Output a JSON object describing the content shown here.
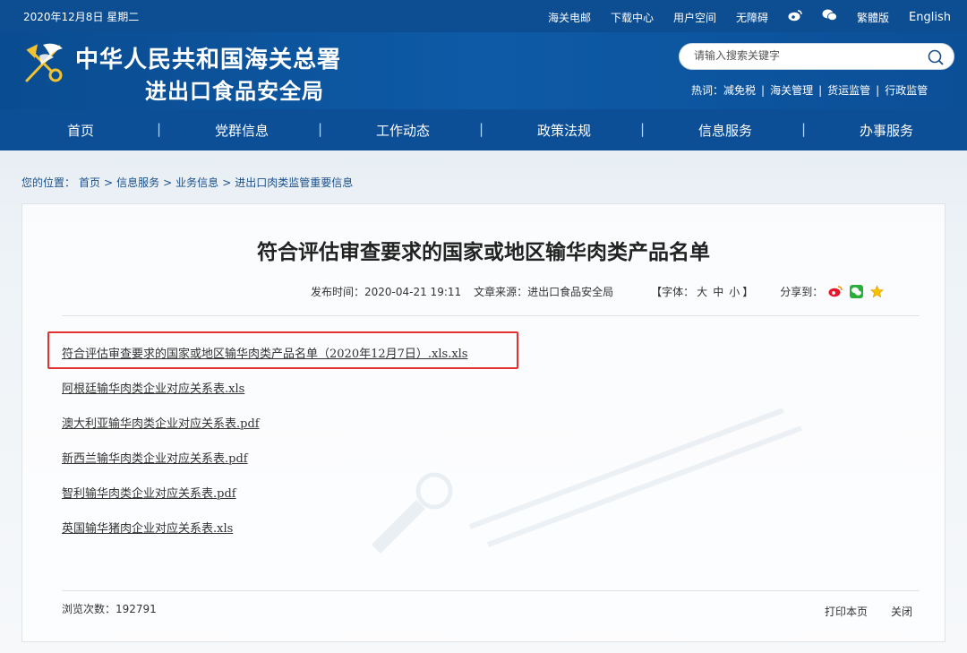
{
  "topbar": {
    "date": "2020年12月8日 星期二",
    "links": {
      "email": "海关电邮",
      "download": "下载中心",
      "user_space": "用户空间",
      "accessibility": "无障碍",
      "traditional": "繁體版",
      "english": "English"
    }
  },
  "header": {
    "title_line1": "中华人民共和国海关总署",
    "title_line2": "进出口食品安全局",
    "search": {
      "placeholder": "请输入搜索关键字"
    },
    "hot": {
      "label": "热词：",
      "items": [
        "减免税",
        "海关管理",
        "货运监管",
        "行政监管"
      ]
    }
  },
  "nav": {
    "items": [
      "首页",
      "党群信息",
      "工作动态",
      "政策法规",
      "信息服务",
      "办事服务"
    ]
  },
  "breadcrumb": {
    "label": "您的位置：",
    "items": [
      "首页",
      "信息服务",
      "业务信息",
      "进出口肉类监管重要信息"
    ],
    "separator": ">"
  },
  "article": {
    "title": "符合评估审查要求的国家或地区输华肉类产品名单",
    "publish_time": "发布时间：2020-04-21 19:11",
    "source": "文章来源：进出口食品安全局",
    "font_label": "【字体：",
    "font_sizes": [
      "大",
      "中",
      "小"
    ],
    "font_close": "】",
    "share_label": "分享到："
  },
  "files": [
    "符合评估审查要求的国家或地区输华肉类产品名单（2020年12月7日）.xls.xls",
    "阿根廷输华肉类企业对应关系表.xls",
    "澳大利亚输华肉类企业对应关系表.pdf",
    "新西兰输华肉类企业对应关系表.pdf",
    "智利输华肉类企业对应关系表.pdf",
    "英国输华猪肉企业对应关系表.xls"
  ],
  "footer": {
    "views": "浏览次数：192791",
    "print": "打印本页",
    "close": "关闭"
  },
  "colors": {
    "brand_blue": "#0c4f97",
    "highlight_red": "#e33131"
  }
}
